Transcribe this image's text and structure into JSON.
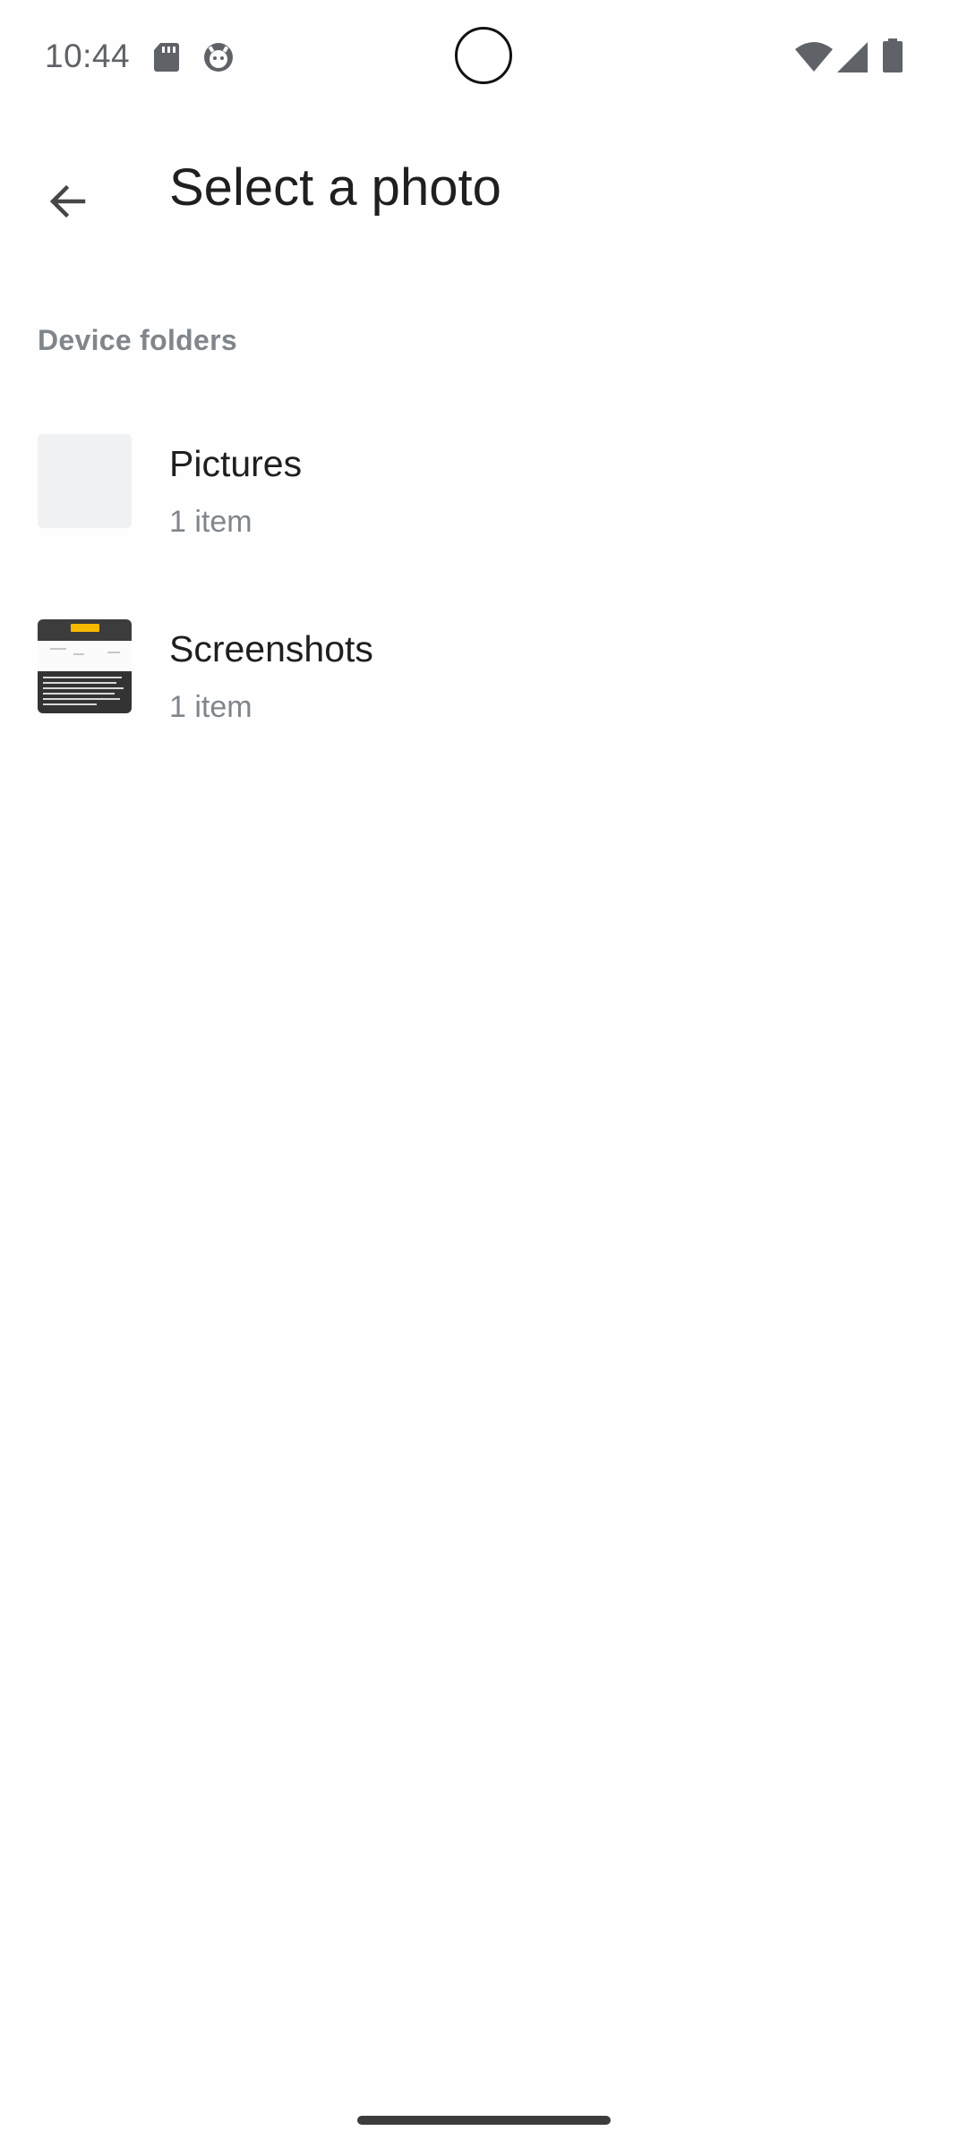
{
  "status_bar": {
    "time": "10:44",
    "icons": [
      "sd-card-icon",
      "android-face-icon",
      "wifi-icon",
      "cellular-signal-icon",
      "battery-icon"
    ]
  },
  "app_bar": {
    "back_icon": "arrow-back-icon",
    "title": "Select a photo"
  },
  "section": {
    "header": "Device folders"
  },
  "folders": [
    {
      "name": "Pictures",
      "count": "1 item"
    },
    {
      "name": "Screenshots",
      "count": "1 item"
    }
  ],
  "colors": {
    "background": "#fefefe",
    "primary_text": "#1f1f1f",
    "secondary_text": "#80868b",
    "thumbnail_placeholder": "#f0f1f3"
  }
}
